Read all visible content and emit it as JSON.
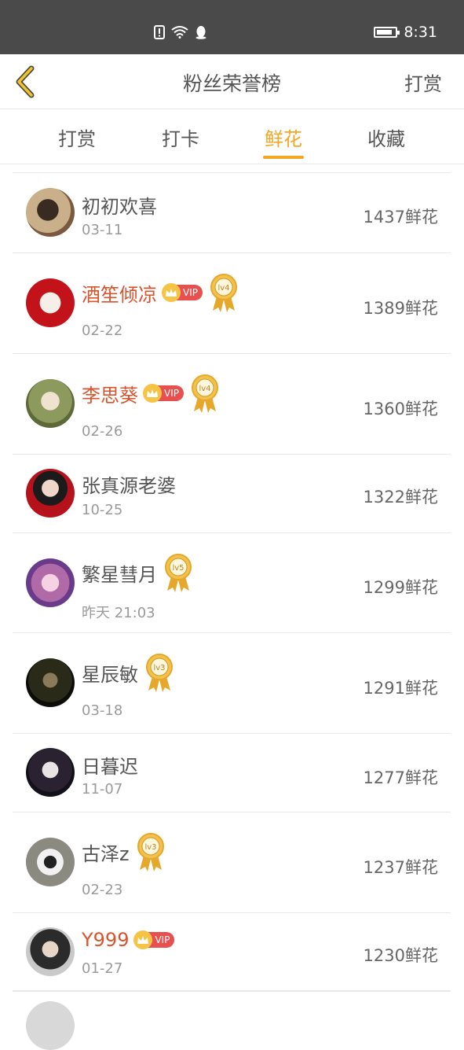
{
  "statusbar": {
    "time": "8:31"
  },
  "header": {
    "title": "粉丝荣誉榜",
    "action_label": "打赏"
  },
  "tabs": [
    {
      "label": "打赏",
      "active": false
    },
    {
      "label": "打卡",
      "active": false
    },
    {
      "label": "鲜花",
      "active": true
    },
    {
      "label": "收藏",
      "active": false
    }
  ],
  "fans": [
    {
      "name": "初初欢喜",
      "date": "03-11",
      "count": "1437鲜花",
      "vip": false,
      "level": ""
    },
    {
      "name": "酒笙倾凉",
      "date": "02-22",
      "count": "1389鲜花",
      "vip": true,
      "level": "lv4"
    },
    {
      "name": "李思葵",
      "date": "02-26",
      "count": "1360鲜花",
      "vip": true,
      "level": "lv4"
    },
    {
      "name": "张真源老婆",
      "date": "10-25",
      "count": "1322鲜花",
      "vip": false,
      "level": ""
    },
    {
      "name": "繁星彗月",
      "date": "昨天 21:03",
      "count": "1299鲜花",
      "vip": false,
      "level": "lv5"
    },
    {
      "name": "星辰敏",
      "date": "03-18",
      "count": "1291鲜花",
      "vip": false,
      "level": "lv3"
    },
    {
      "name": "日暮迟",
      "date": "11-07",
      "count": "1277鲜花",
      "vip": false,
      "level": ""
    },
    {
      "name": "古泽z",
      "date": "02-23",
      "count": "1237鲜花",
      "vip": false,
      "level": "lv3"
    },
    {
      "name": "Y999",
      "date": "01-27",
      "count": "1230鲜花",
      "vip": true,
      "level": ""
    }
  ],
  "vip_label": "VIP",
  "colors": {
    "accent": "#f5a623",
    "vip_name": "#d9532c",
    "vip_badge": "#e84f4f"
  }
}
